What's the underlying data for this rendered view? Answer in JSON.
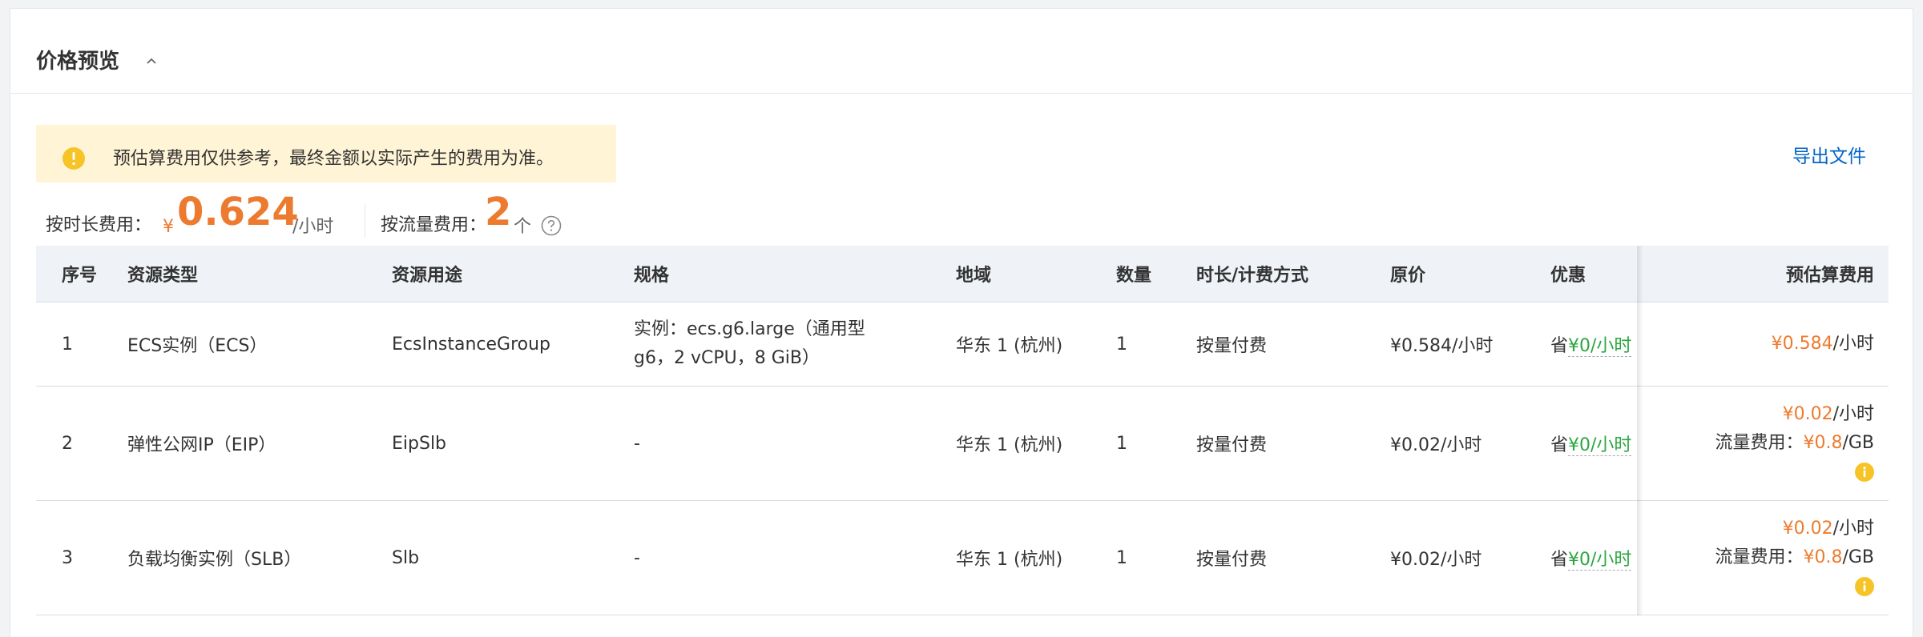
{
  "panel": {
    "title": "价格预览",
    "notice": "预估算费用仅供参考，最终金额以实际产生的费用为准。",
    "export": "导出文件"
  },
  "cost": {
    "hourly_label": "按时长费用：",
    "hourly_currency": "¥",
    "hourly_value": "0.624",
    "hourly_unit": "/小时",
    "traffic_label": "按流量费用：",
    "traffic_value": "2",
    "traffic_unit": "个"
  },
  "table": {
    "headers": {
      "index": "序号",
      "type": "资源类型",
      "usage": "资源用途",
      "spec": "规格",
      "region": "地域",
      "qty": "数量",
      "billing": "时长/计费方式",
      "price": "原价",
      "discount": "优惠",
      "estimate": "预估算费用"
    },
    "rows": [
      {
        "index": "1",
        "type": "ECS实例（ECS）",
        "usage": "EcsInstanceGroup",
        "spec": "实例：ecs.g6.large（通用型 g6，2 vCPU，8 GiB）",
        "region": "华东 1 (杭州)",
        "qty": "1",
        "billing": "按量付费",
        "price": "¥0.584/小时",
        "discount_prefix": "省",
        "discount_value": "¥0/小时",
        "est_value": "¥0.584",
        "est_unit": "/小时"
      },
      {
        "index": "2",
        "type": "弹性公网IP（EIP）",
        "usage": "EipSlb",
        "spec": "-",
        "region": "华东 1 (杭州)",
        "qty": "1",
        "billing": "按量付费",
        "price": "¥0.02/小时",
        "discount_prefix": "省",
        "discount_value": "¥0/小时",
        "est_value": "¥0.02",
        "est_unit": "/小时",
        "traffic_label": "流量费用：",
        "traffic_value": "¥0.8",
        "traffic_unit": "/GB"
      },
      {
        "index": "3",
        "type": "负载均衡实例（SLB）",
        "usage": "Slb",
        "spec": "-",
        "region": "华东 1 (杭州)",
        "qty": "1",
        "billing": "按量付费",
        "price": "¥0.02/小时",
        "discount_prefix": "省",
        "discount_value": "¥0/小时",
        "est_value": "¥0.02",
        "est_unit": "/小时",
        "traffic_label": "流量费用：",
        "traffic_value": "¥0.8",
        "traffic_unit": "/GB"
      }
    ]
  },
  "icons": {
    "collapse": "chevron-up-icon",
    "notice": "warning-circle-icon",
    "help": "question-circle-icon",
    "info": "info-circle-icon"
  },
  "colors": {
    "accent_orange": "#ed7b2f",
    "saving_green": "#2da641",
    "link_blue": "#0064c8",
    "notice_bg": "#fff4d5",
    "info_yellow": "#f7c427"
  }
}
